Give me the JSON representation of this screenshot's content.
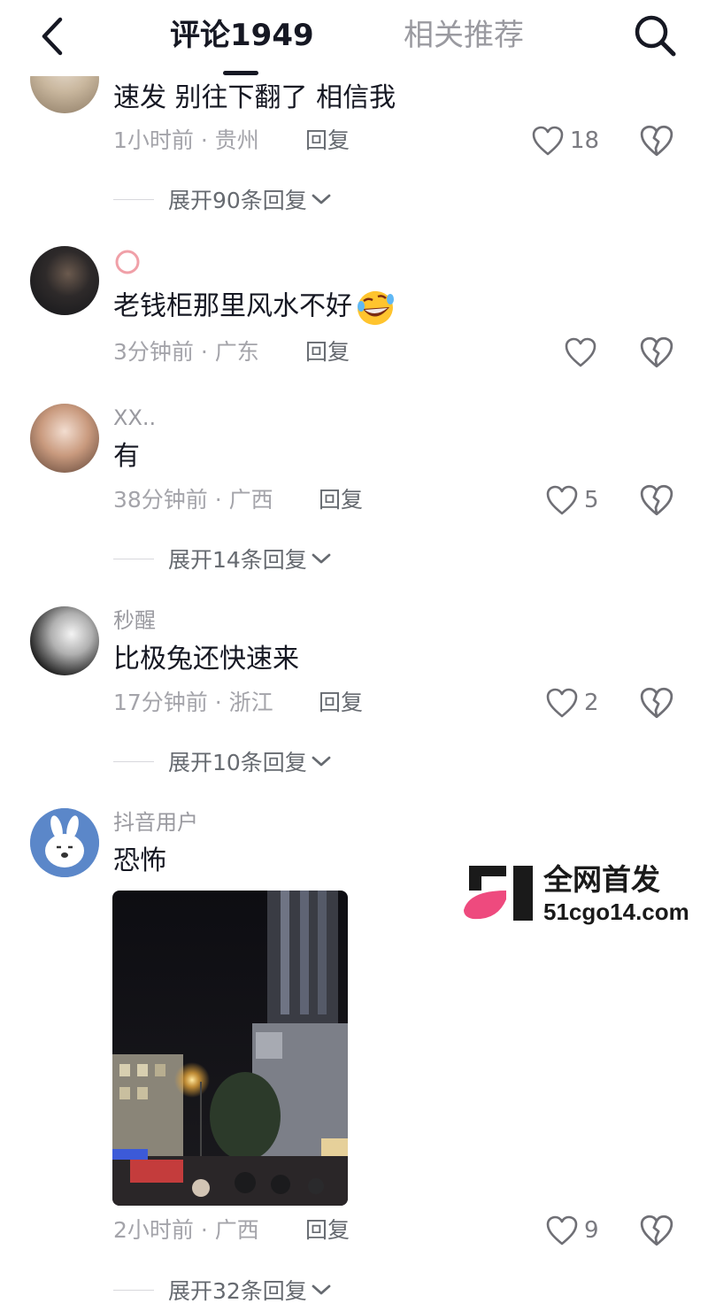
{
  "header": {
    "back_icon": "chevron-left-icon",
    "tab_comments": "评论1949",
    "tab_recommend": "相关推荐",
    "search_icon": "search-icon"
  },
  "colors": {
    "text_primary": "#161823",
    "text_secondary": "#a4a4aa",
    "accent_pink": "#ee4a7e"
  },
  "comments": [
    {
      "nickname": "",
      "content": "速发 别往下翻了 相信我",
      "time": "1小时前",
      "location": "贵州",
      "reply_label": "回复",
      "likes": "18",
      "expand_label": "展开90条回复"
    },
    {
      "nickname": "",
      "content": "老钱柜那里风水不好",
      "time": "3分钟前",
      "location": "广东",
      "reply_label": "回复",
      "likes": "",
      "emoji": "rofl-emoji"
    },
    {
      "nickname": "XX..",
      "content": "有",
      "time": "38分钟前",
      "location": "广西",
      "reply_label": "回复",
      "likes": "5",
      "expand_label": "展开14条回复"
    },
    {
      "nickname": "秒醒",
      "content": "比极兔还快速来",
      "time": "17分钟前",
      "location": "浙江",
      "reply_label": "回复",
      "likes": "2",
      "expand_label": "展开10条回复"
    },
    {
      "nickname": "抖音用户",
      "content": "恐怖",
      "time": "2小时前",
      "location": "广西",
      "reply_label": "回复",
      "likes": "9",
      "expand_label": "展开32条回复"
    }
  ],
  "separator": " · ",
  "watermark": {
    "line1": "全网首发",
    "line2": "51cgo14.com"
  }
}
